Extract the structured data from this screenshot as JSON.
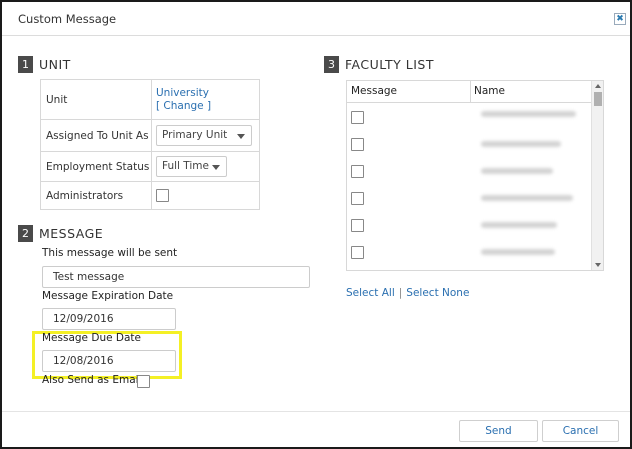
{
  "dialog": {
    "title": "Custom Message",
    "close_glyph": "✖"
  },
  "unit_section": {
    "number": "1",
    "title": "UNIT",
    "unit_label": "Unit",
    "unit_value": "University",
    "change_link": "[ Change ]",
    "assigned_label": "Assigned To Unit As",
    "assigned_value": "Primary Unit",
    "employment_label": "Employment Status",
    "employment_value": "Full Time",
    "admins_label": "Administrators",
    "admins_checked": false
  },
  "message_section": {
    "number": "2",
    "title": "MESSAGE",
    "message_label": "This message will be sent",
    "message_value": "Test message",
    "expiration_label": "Message Expiration Date",
    "expiration_value": "12/09/2016",
    "due_label": "Message Due Date",
    "due_value": "12/08/2016",
    "email_label": "Also Send as Email",
    "email_checked": false
  },
  "faculty_section": {
    "number": "3",
    "title": "FACULTY LIST",
    "columns": [
      "Message",
      "Name"
    ],
    "select_all": "Select All",
    "select_divider": "|",
    "select_none": "Select None"
  },
  "footer": {
    "send_label": "Send",
    "cancel_label": "Cancel"
  },
  "colors": {
    "highlight": "#f4f025",
    "link": "#2a6fb0",
    "section_badge": "#4a4a4a"
  }
}
